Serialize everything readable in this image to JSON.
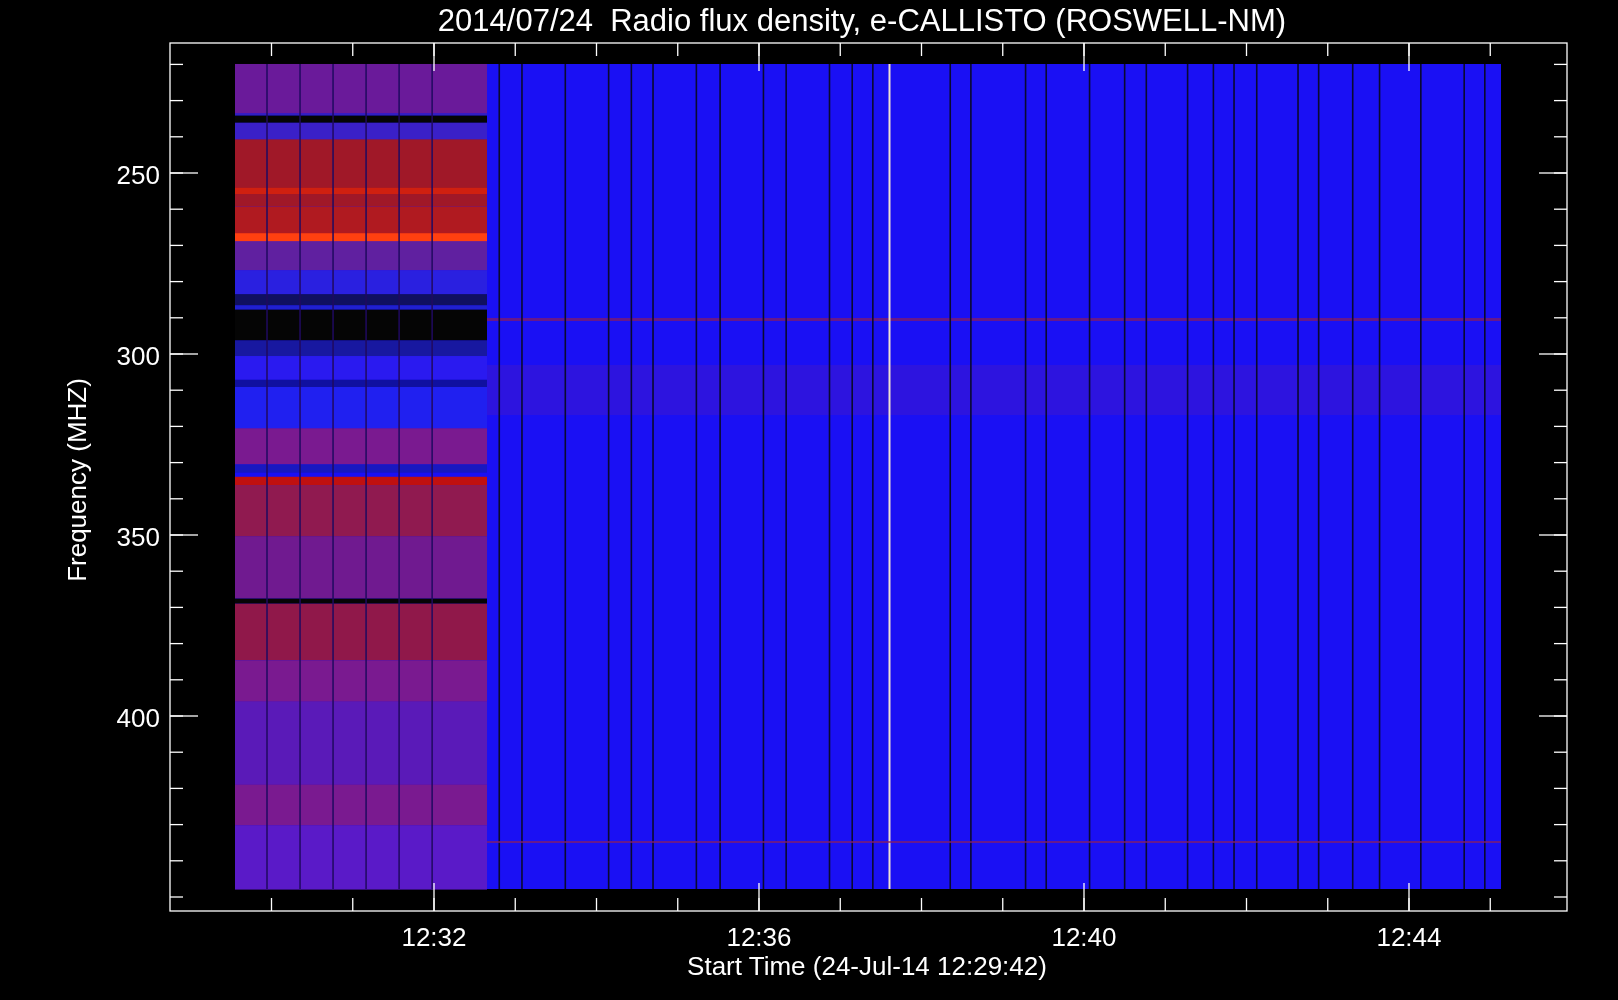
{
  "title": "2014/07/24  Radio flux density, e-CALLISTO (ROSWELL-NM)",
  "plot": {
    "ylabel": "Frequency (MHZ)",
    "xlabel": "Start Time (24-Jul-14 12:29:42)",
    "y_tick_labels": [
      "250",
      "300",
      "350",
      "400"
    ],
    "x_tick_labels": [
      "12:32",
      "12:36",
      "12:40",
      "12:44"
    ]
  }
}
